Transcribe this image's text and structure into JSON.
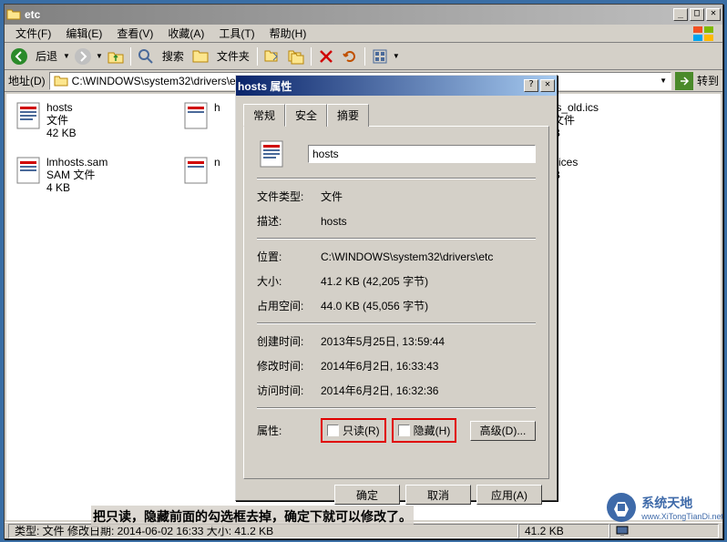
{
  "explorer": {
    "title": "etc",
    "menus": [
      "文件(F)",
      "编辑(E)",
      "查看(V)",
      "收藏(A)",
      "工具(T)",
      "帮助(H)"
    ],
    "toolbar": {
      "back": "后退",
      "search": "搜索",
      "folders": "文件夹"
    },
    "address": {
      "label": "地址(D)",
      "path": "C:\\WINDOWS\\system32\\drivers\\etc",
      "go": "转到"
    },
    "files": [
      {
        "name": "hosts",
        "type": "文件",
        "size": "42 KB"
      },
      {
        "name": "lmhosts.sam",
        "type": "SAM 文件",
        "size": "4 KB"
      },
      {
        "name_partial": "h",
        "type": "",
        "size": ""
      },
      {
        "name_partial": "n",
        "type": "",
        "size": ""
      },
      {
        "name": "ts_old.ics",
        "type": "文件",
        "size": "B"
      },
      {
        "name": "vices",
        "type": "",
        "size": "B"
      }
    ],
    "status": {
      "left": "类型: 文件 修改日期: 2014-06-02 16:33 大小: 41.2 KB",
      "size": "41.2 KB"
    }
  },
  "dialog": {
    "title": "hosts 属性",
    "tabs": [
      "常规",
      "安全",
      "摘要"
    ],
    "filename": "hosts",
    "rows": {
      "filetype_label": "文件类型:",
      "filetype_value": "文件",
      "desc_label": "描述:",
      "desc_value": "hosts",
      "location_label": "位置:",
      "location_value": "C:\\WINDOWS\\system32\\drivers\\etc",
      "size_label": "大小:",
      "size_value": "41.2 KB (42,205 字节)",
      "ondisk_label": "占用空间:",
      "ondisk_value": "44.0 KB (45,056 字节)",
      "created_label": "创建时间:",
      "created_value": "2013年5月25日, 13:59:44",
      "modified_label": "修改时间:",
      "modified_value": "2014年6月2日, 16:33:43",
      "accessed_label": "访问时间:",
      "accessed_value": "2014年6月2日, 16:32:36",
      "attrs_label": "属性:",
      "readonly": "只读(R)",
      "hidden": "隐藏(H)",
      "advanced": "高级(D)..."
    },
    "buttons": {
      "ok": "确定",
      "cancel": "取消",
      "apply": "应用(A)"
    }
  },
  "annotation": "把只读，隐藏前面的勾选框去掉，确定下就可以修改了。",
  "watermark": {
    "title": "系统天地",
    "url": "www.XiTongTianDi.net"
  }
}
